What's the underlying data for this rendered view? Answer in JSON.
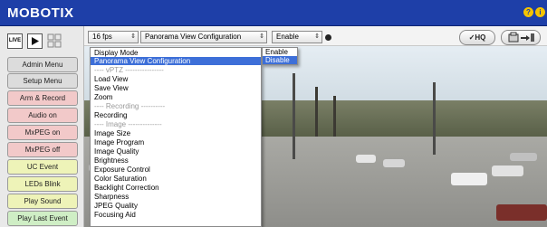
{
  "header": {
    "brand": "MOBOTIX",
    "help_icon": "question-icon",
    "info_icon": "info-icon"
  },
  "view_buttons": {
    "live_label": "LIVE",
    "play_icon": "play-icon",
    "grid_icon": "grid-icon"
  },
  "sidebar": {
    "items": [
      {
        "label": "Admin Menu",
        "color": "#dcdcdc"
      },
      {
        "label": "Setup Menu",
        "color": "#dcdcdc"
      },
      {
        "label": "Arm & Record",
        "color": "#f2c9c9"
      },
      {
        "label": "Audio on",
        "color": "#f2c9c9"
      },
      {
        "label": "MxPEG on",
        "color": "#f2c9c9"
      },
      {
        "label": "MxPEG off",
        "color": "#f2c9c9"
      },
      {
        "label": "UC Event",
        "color": "#eef3b8"
      },
      {
        "label": "LEDs Blink",
        "color": "#eef3b8"
      },
      {
        "label": "Play Sound",
        "color": "#eef3b8"
      },
      {
        "label": "Play Last Event",
        "color": "#cfeec5"
      }
    ]
  },
  "toolbar": {
    "fps_select": "16 fps",
    "config_select": "Panorama View Configuration",
    "enable_select": "Enable",
    "hq_button": "HQ",
    "export_icon": "export-icon",
    "arrows": "⇕"
  },
  "config_menu": {
    "items": [
      {
        "label": "Display Mode",
        "kind": "item"
      },
      {
        "label": "Panorama View Configuration",
        "kind": "selected"
      },
      {
        "label": "---- vPTZ ----------------",
        "kind": "sep"
      },
      {
        "label": "Load View",
        "kind": "item"
      },
      {
        "label": "Save View",
        "kind": "item"
      },
      {
        "label": "Zoom",
        "kind": "item"
      },
      {
        "label": "---- Recording ----------",
        "kind": "sep"
      },
      {
        "label": "Recording",
        "kind": "item"
      },
      {
        "label": "---- Image --------------",
        "kind": "sep"
      },
      {
        "label": "Image Size",
        "kind": "item"
      },
      {
        "label": "Image Program",
        "kind": "item"
      },
      {
        "label": "Image Quality",
        "kind": "item"
      },
      {
        "label": "Brightness",
        "kind": "item"
      },
      {
        "label": "Exposure Control",
        "kind": "item"
      },
      {
        "label": "Color Saturation",
        "kind": "item"
      },
      {
        "label": "Backlight Correction",
        "kind": "item"
      },
      {
        "label": "Sharpness",
        "kind": "item"
      },
      {
        "label": "JPEG Quality",
        "kind": "item"
      },
      {
        "label": "Focusing Aid",
        "kind": "item"
      }
    ]
  },
  "enable_menu": {
    "items": [
      {
        "label": "Enable",
        "kind": "item"
      },
      {
        "label": "Disable",
        "kind": "selected"
      }
    ]
  }
}
